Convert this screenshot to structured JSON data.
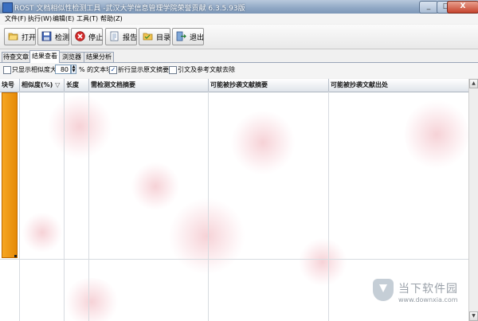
{
  "window": {
    "title": "ROST 文档相似性检测工具 -武汉大学信息管理学院荣誉贡献 6.3.5.93版",
    "controls": [
      "_",
      "□",
      "X"
    ]
  },
  "menu": [
    "文件(F)",
    "执行(W)",
    "编辑(E)",
    "工具(T)",
    "帮助(Z)"
  ],
  "toolbar": [
    {
      "label": "打开",
      "icon": "open-folder-icon"
    },
    {
      "label": "检测",
      "icon": "save-disk-icon"
    },
    {
      "label": "停止",
      "icon": "stop-icon"
    },
    {
      "label": "报告",
      "icon": "report-icon"
    },
    {
      "label": "目录",
      "icon": "directory-icon"
    },
    {
      "label": "退出",
      "icon": "exit-icon"
    }
  ],
  "tabs": [
    {
      "label": "待查文章",
      "active": false
    },
    {
      "label": "结果查看",
      "active": true
    },
    {
      "label": "浏览器",
      "active": false
    },
    {
      "label": "结果分析",
      "active": false
    }
  ],
  "options": {
    "only_show_prefix": "只显示相似度大",
    "threshold": "80",
    "only_show_suffix": "% 的文本块",
    "wrap_label": "折行显示原文摘要",
    "remove_citation_label": "引文及参考文献去除",
    "only_show_checked": false,
    "wrap_checked": true,
    "remove_citation_checked": false
  },
  "grid": {
    "columns": [
      "块号",
      "相似度(%)",
      "长度",
      "需检测文档摘要",
      "可能被抄袭文献摘要",
      "可能被抄袭文献出处"
    ],
    "sort_indicator": "▽"
  },
  "scroll": {
    "up": "▲",
    "down": "▼"
  },
  "watermark": {
    "name": "当下软件园",
    "url": "www.downxia.com"
  },
  "colors": {
    "indicator": "#f6a623",
    "title_bar": "#8fa7c4"
  }
}
